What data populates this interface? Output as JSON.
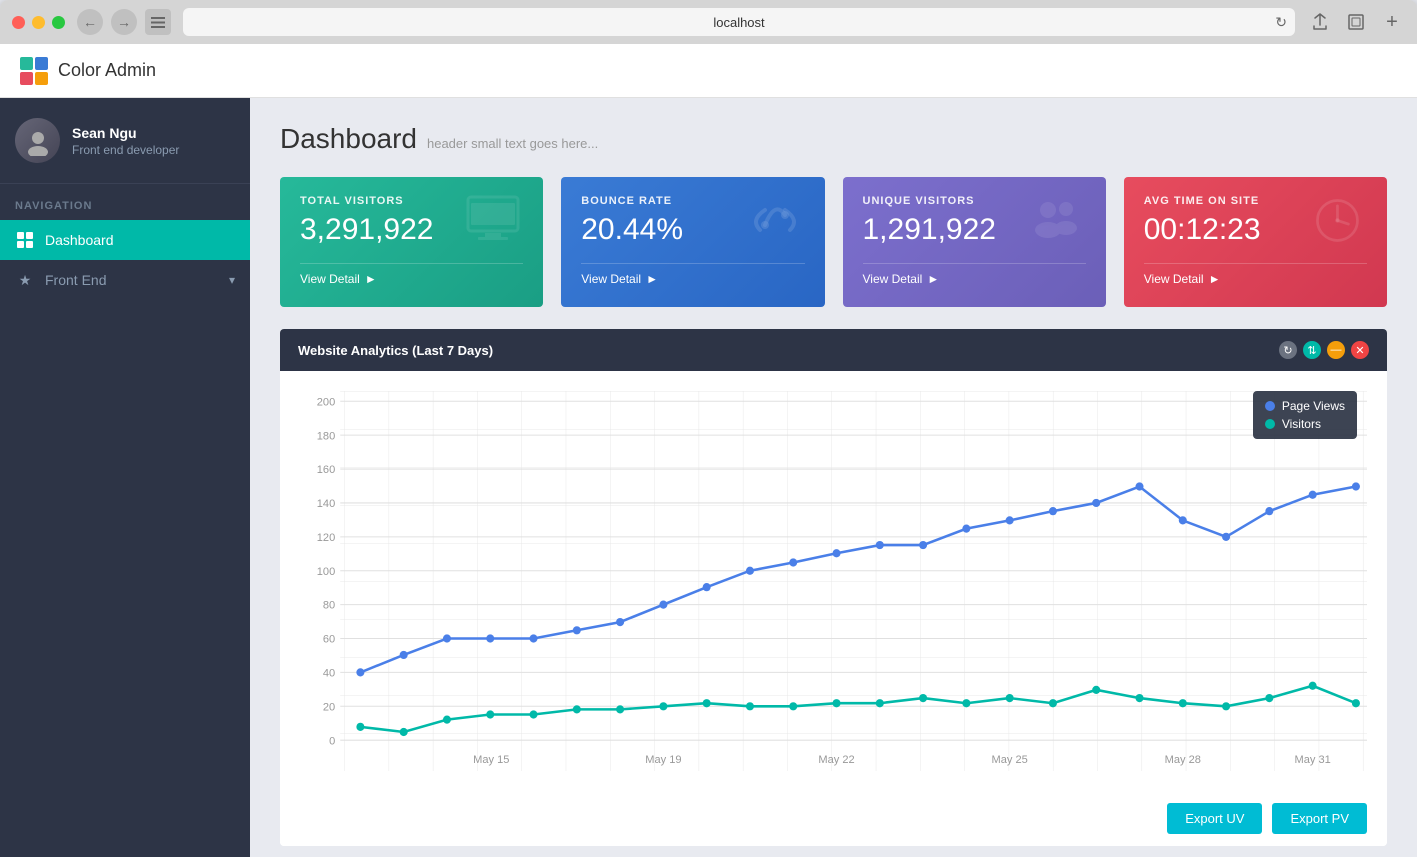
{
  "browser": {
    "url": "localhost",
    "buttons": {
      "close": "●",
      "minimize": "●",
      "maximize": "●"
    }
  },
  "app": {
    "logo_alt": "Color Admin",
    "title": "Color Admin"
  },
  "sidebar": {
    "user": {
      "name": "Sean Ngu",
      "role": "Front end developer"
    },
    "nav_label": "Navigation",
    "items": [
      {
        "id": "dashboard",
        "label": "Dashboard",
        "icon": "⊞",
        "active": true
      },
      {
        "id": "frontend",
        "label": "Front End",
        "icon": "★",
        "active": false,
        "has_submenu": true
      }
    ]
  },
  "page": {
    "title": "Dashboard",
    "subtitle": "header small text goes here..."
  },
  "stat_cards": [
    {
      "id": "total-visitors",
      "label": "TOTAL VISITORS",
      "value": "3,291,922",
      "icon": "🖥",
      "footer": "View Detail",
      "color_class": "stat-card-teal"
    },
    {
      "id": "bounce-rate",
      "label": "BOUNCE RATE",
      "value": "20.44%",
      "icon": "🔗",
      "footer": "View Detail",
      "color_class": "stat-card-blue"
    },
    {
      "id": "unique-visitors",
      "label": "UNIQUE VISITORS",
      "value": "1,291,922",
      "icon": "👥",
      "footer": "View Detail",
      "color_class": "stat-card-purple"
    },
    {
      "id": "avg-time",
      "label": "AVG TIME ON SITE",
      "value": "00:12:23",
      "icon": "⏱",
      "footer": "View Detail",
      "color_class": "stat-card-red"
    }
  ],
  "chart": {
    "title": "Website Analytics (Last 7 Days)",
    "legend": {
      "page_views": "Page Views",
      "visitors": "Visitors"
    },
    "x_labels": [
      "May 15",
      "May 19",
      "May 22",
      "May 25",
      "May 28",
      "May 31"
    ],
    "y_labels": [
      "0",
      "20",
      "40",
      "60",
      "80",
      "100",
      "120",
      "140",
      "160",
      "180",
      "200"
    ],
    "page_views_data": [
      40,
      50,
      60,
      60,
      60,
      65,
      70,
      80,
      90,
      100,
      105,
      110,
      115,
      115,
      125,
      130,
      135,
      140,
      150,
      130,
      120,
      135,
      145,
      150
    ],
    "visitors_data": [
      8,
      5,
      12,
      15,
      15,
      18,
      18,
      20,
      22,
      20,
      20,
      22,
      22,
      25,
      22,
      25,
      22,
      30,
      25,
      22,
      20,
      25,
      32,
      22
    ],
    "actions": {
      "gray": "⟳",
      "teal": "↕",
      "orange": "—",
      "red": "✕"
    },
    "export_uv": "Export UV",
    "export_pv": "Export PV"
  }
}
